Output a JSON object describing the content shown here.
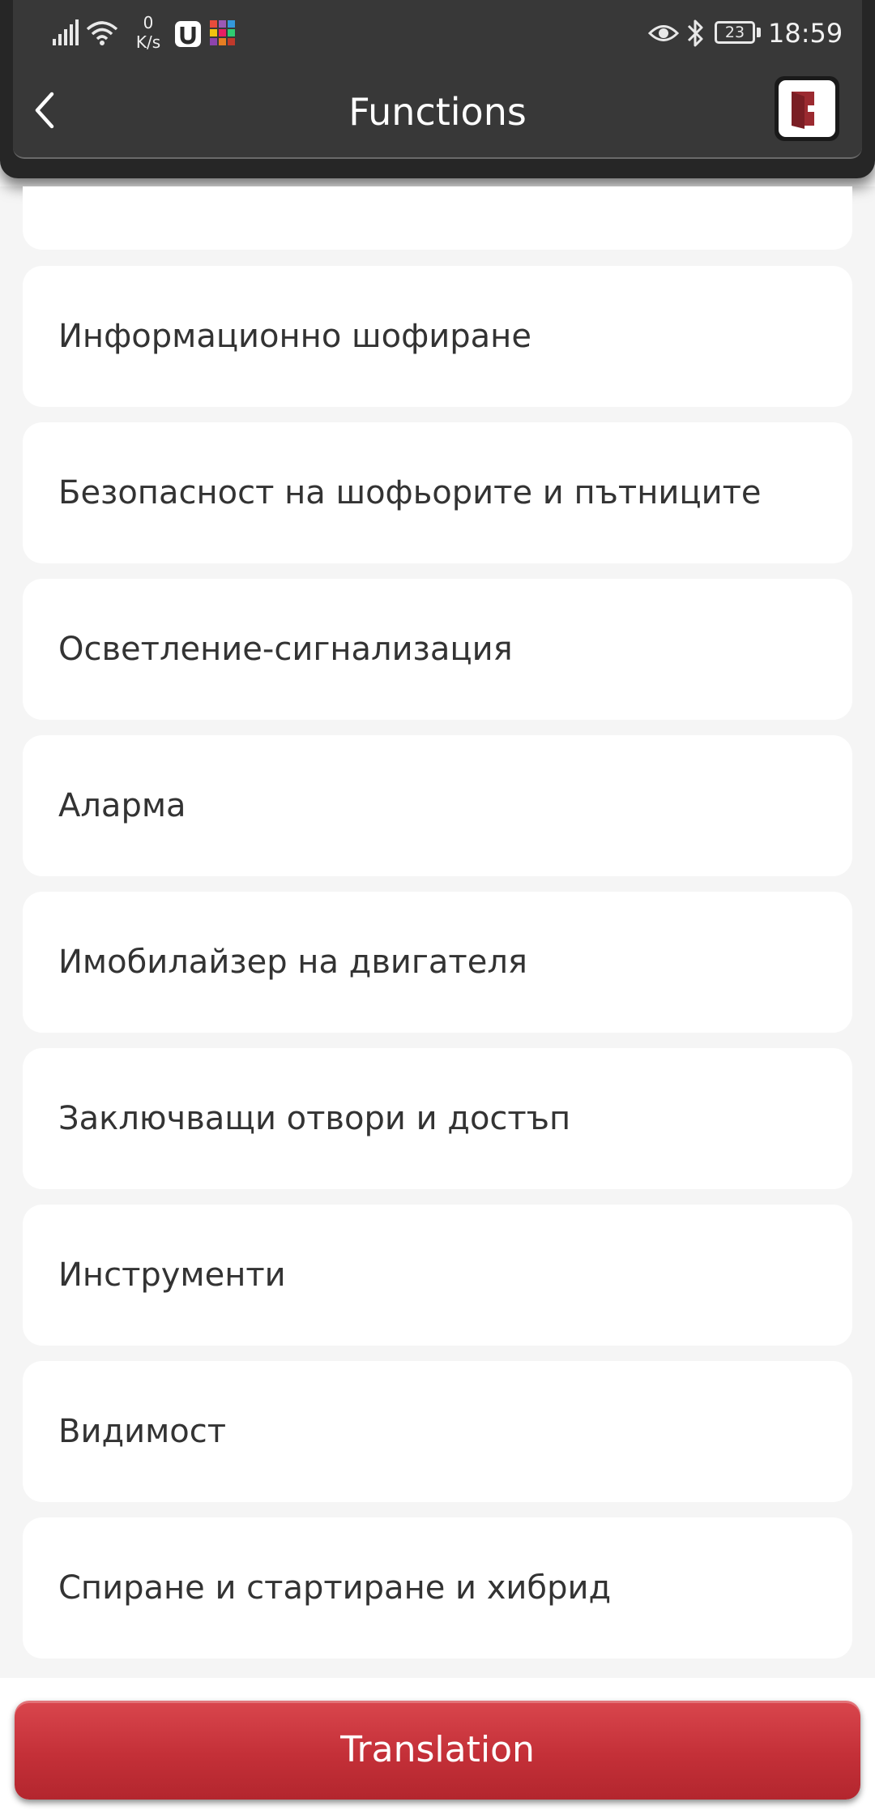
{
  "status_bar": {
    "net_speed_value": "0",
    "net_speed_unit": "K/s",
    "battery_level": "23",
    "time": "18:59",
    "icons": [
      "signal-icon",
      "wifi-icon",
      "app-u-icon",
      "app-grid-icon",
      "eye-comfort-icon",
      "bluetooth-icon",
      "battery-icon"
    ]
  },
  "nav": {
    "title": "Functions",
    "back_icon": "chevron-left-icon",
    "exit_icon": "exit-door-icon"
  },
  "functions": [
    {
      "label": "Информационно шофиране"
    },
    {
      "label": "Безопасност на шофьорите и пътниците"
    },
    {
      "label": "Осветление-сигнализация"
    },
    {
      "label": "Аларма"
    },
    {
      "label": "Имобилайзер на двигателя"
    },
    {
      "label": "Заключващи отвори и достъп"
    },
    {
      "label": "Инструменти"
    },
    {
      "label": "Видимост"
    },
    {
      "label": "Спиране и стартиране и хибрид"
    }
  ],
  "bottom": {
    "translate_label": "Translation"
  },
  "colors": {
    "header_bg": "#383838",
    "page_bg": "#f5f5f5",
    "card_bg": "#ffffff",
    "accent_red": "#c43038",
    "exit_icon_red": "#9b2a30"
  }
}
